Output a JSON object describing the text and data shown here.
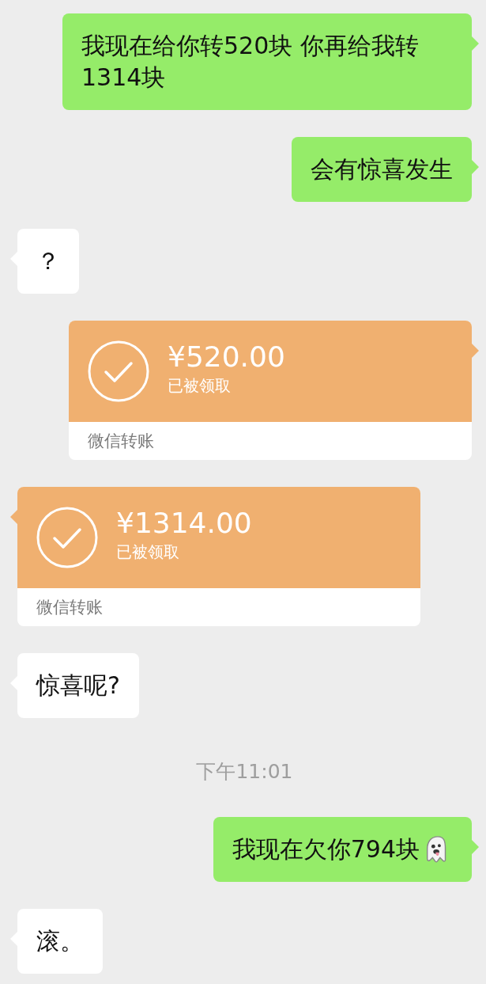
{
  "messages": [
    {
      "kind": "text",
      "outgoing": true,
      "text": "我现在给你转520块 你再给我转1314块"
    },
    {
      "kind": "text",
      "outgoing": true,
      "text": "会有惊喜发生"
    },
    {
      "kind": "text",
      "outgoing": false,
      "text": "？"
    },
    {
      "kind": "transfer",
      "outgoing": true,
      "amount": "¥520.00",
      "status": "已被领取",
      "footer": "微信转账"
    },
    {
      "kind": "transfer",
      "outgoing": false,
      "amount": "¥1314.00",
      "status": "已被领取",
      "footer": "微信转账"
    },
    {
      "kind": "text",
      "outgoing": false,
      "text": "惊喜呢?"
    },
    {
      "kind": "time",
      "text": "下午11:01"
    },
    {
      "kind": "text",
      "outgoing": true,
      "text": "我现在欠你794块",
      "ghost_emoji": true
    },
    {
      "kind": "text",
      "outgoing": false,
      "text": "滚。"
    }
  ]
}
